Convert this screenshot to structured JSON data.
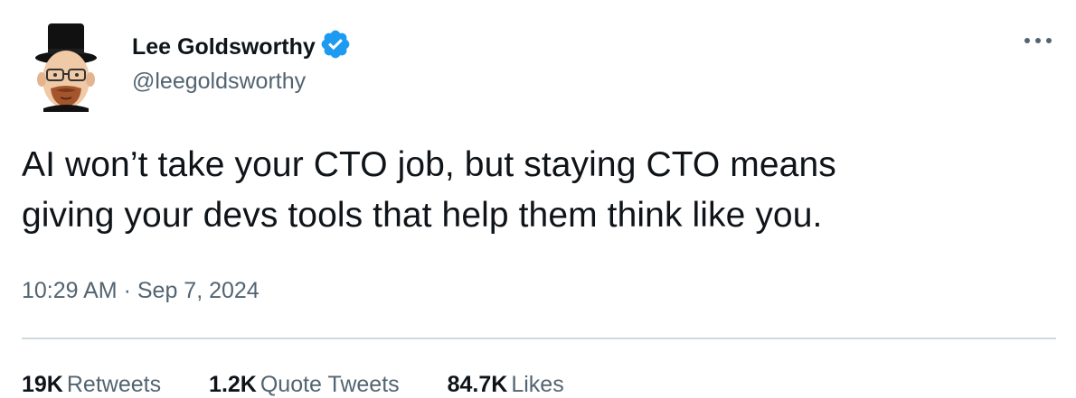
{
  "author": {
    "display_name": "Lee Goldsworthy",
    "handle": "@leegoldsworthy",
    "verified": true
  },
  "icons": {
    "avatar": "avatar-illustration-top-hat",
    "verified": "verified-badge-icon",
    "more": "more-options-icon"
  },
  "tweet": {
    "text": "AI won’t take your CTO job, but staying CTO means\ngiving your devs tools that help them think like you.",
    "time": "10:29 AM",
    "separator": "·",
    "date": "Sep 7, 2024"
  },
  "stats": {
    "retweets": {
      "count": "19K",
      "label": "Retweets"
    },
    "quotes": {
      "count": "1.2K",
      "label": "Quote Tweets"
    },
    "likes": {
      "count": "84.7K",
      "label": "Likes"
    }
  },
  "colors": {
    "text_primary": "#0f1419",
    "text_secondary": "#536471",
    "verified_blue": "#1d9bf0",
    "divider": "#cfd9de"
  }
}
